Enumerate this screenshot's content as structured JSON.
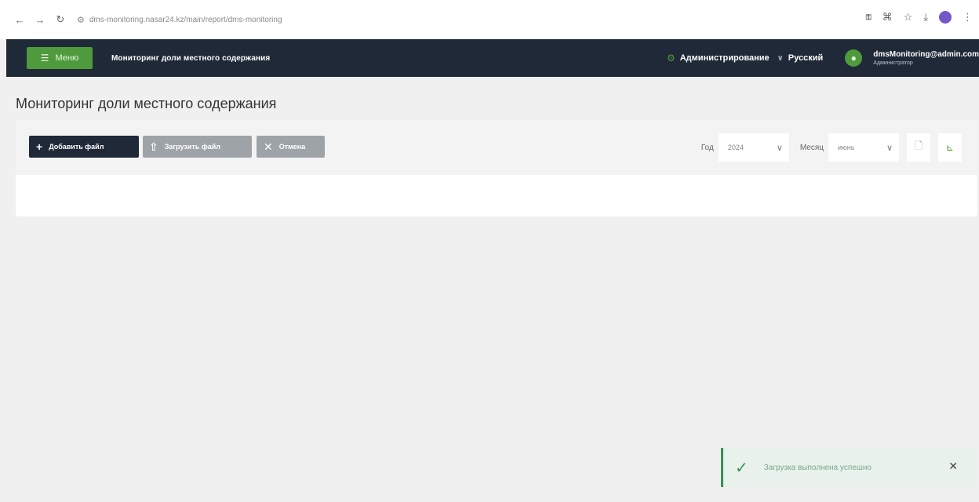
{
  "browser": {
    "url": "dms-monitoring.nasar24.kz/main/report/dms-monitoring"
  },
  "header": {
    "menu_label": "Меню",
    "app_title": "Мониторинг доли местного содержания",
    "admin_label": "Администрирование",
    "language": "Русский",
    "user": {
      "name": "dmsMonitoring@admin.com",
      "role": "Администратор"
    }
  },
  "page": {
    "title": "Мониторинг доли местного содержания"
  },
  "toolbar": {
    "add_file": "Добавить файл",
    "upload_file": "Загрузить файл",
    "cancel": "Отмена"
  },
  "filters": {
    "year_label": "Год",
    "year_value": "2024",
    "month_label": "Месяц",
    "month_value": "июнь"
  },
  "toast": {
    "message": "Загрузка выполнена успешно"
  },
  "colors": {
    "header_bg": "#1f2937",
    "accent_green": "#4f9a3c",
    "disabled_button": "#9ea3a8",
    "toast_bg": "#e8f1ec"
  }
}
